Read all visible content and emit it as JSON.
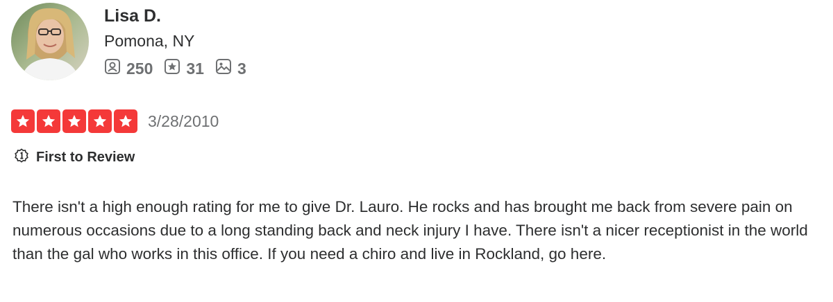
{
  "user": {
    "name": "Lisa D.",
    "location": "Pomona, NY",
    "stats": {
      "friends": "250",
      "reviews": "31",
      "photos": "3"
    }
  },
  "review": {
    "rating": 5,
    "rating_max": 5,
    "date": "3/28/2010",
    "badge": "First to Review",
    "text": "There isn't a high enough rating for me to give Dr. Lauro.  He rocks and has brought me back from severe pain on numerous occasions due to a long standing back and neck injury I have.  There isn't a nicer receptionist in the world than the gal who works in this office.  If you need a chiro and live in Rockland, go here."
  },
  "colors": {
    "star": "#f43939",
    "text": "#2d2e2f",
    "muted": "#6e7072"
  },
  "icons": {
    "friends": "friends-icon",
    "reviews": "review-star-icon",
    "photos": "photo-icon",
    "badge": "first-to-review-icon"
  }
}
